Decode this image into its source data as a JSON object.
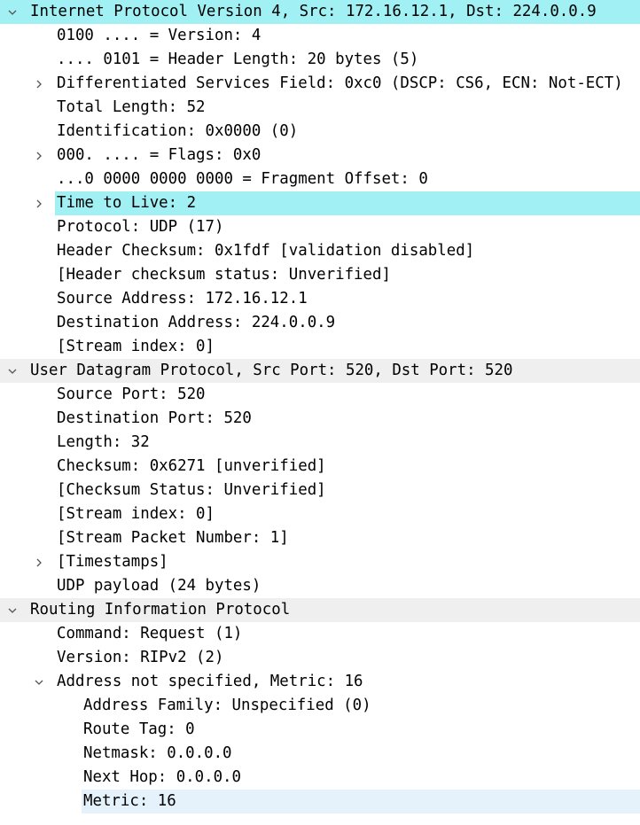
{
  "tree": {
    "rows": [
      {
        "text": "Internet Protocol Version 4, Src: 172.16.12.1, Dst: 224.0.0.9",
        "level": 0,
        "toggle": "expanded",
        "highlight": "cyan",
        "name": "ipv4-header-row"
      },
      {
        "text": "0100 .... = Version: 4",
        "level": 1,
        "toggle": "none",
        "highlight": "none",
        "name": "ipv4-version-row"
      },
      {
        "text": ".... 0101 = Header Length: 20 bytes (5)",
        "level": 1,
        "toggle": "none",
        "highlight": "none",
        "name": "ipv4-header-length-row"
      },
      {
        "text": "Differentiated Services Field: 0xc0 (DSCP: CS6, ECN: Not-ECT)",
        "level": 1,
        "toggle": "collapsed",
        "highlight": "none",
        "name": "ipv4-dsfield-row"
      },
      {
        "text": "Total Length: 52",
        "level": 1,
        "toggle": "none",
        "highlight": "none",
        "name": "ipv4-total-length-row"
      },
      {
        "text": "Identification: 0x0000 (0)",
        "level": 1,
        "toggle": "none",
        "highlight": "none",
        "name": "ipv4-identification-row"
      },
      {
        "text": "000. .... = Flags: 0x0",
        "level": 1,
        "toggle": "collapsed",
        "highlight": "none",
        "name": "ipv4-flags-row"
      },
      {
        "text": "...0 0000 0000 0000 = Fragment Offset: 0",
        "level": 1,
        "toggle": "none",
        "highlight": "none",
        "name": "ipv4-fragment-offset-row"
      },
      {
        "text": "Time to Live: 2",
        "level": 1,
        "toggle": "collapsed",
        "highlight": "cyan",
        "name": "ipv4-ttl-row"
      },
      {
        "text": "Protocol: UDP (17)",
        "level": 1,
        "toggle": "none",
        "highlight": "none",
        "name": "ipv4-protocol-row"
      },
      {
        "text": "Header Checksum: 0x1fdf [validation disabled]",
        "level": 1,
        "toggle": "none",
        "highlight": "none",
        "name": "ipv4-checksum-row"
      },
      {
        "text": "[Header checksum status: Unverified]",
        "level": 1,
        "toggle": "none",
        "highlight": "none",
        "name": "ipv4-checksum-status-row"
      },
      {
        "text": "Source Address: 172.16.12.1",
        "level": 1,
        "toggle": "none",
        "highlight": "none",
        "name": "ipv4-source-address-row"
      },
      {
        "text": "Destination Address: 224.0.0.9",
        "level": 1,
        "toggle": "none",
        "highlight": "none",
        "name": "ipv4-destination-address-row"
      },
      {
        "text": "[Stream index: 0]",
        "level": 1,
        "toggle": "none",
        "highlight": "none",
        "name": "ipv4-stream-index-row"
      },
      {
        "text": "User Datagram Protocol, Src Port: 520, Dst Port: 520",
        "level": 0,
        "toggle": "expanded",
        "highlight": "grey",
        "name": "udp-header-row"
      },
      {
        "text": "Source Port: 520",
        "level": 1,
        "toggle": "none",
        "highlight": "none",
        "name": "udp-source-port-row"
      },
      {
        "text": "Destination Port: 520",
        "level": 1,
        "toggle": "none",
        "highlight": "none",
        "name": "udp-destination-port-row"
      },
      {
        "text": "Length: 32",
        "level": 1,
        "toggle": "none",
        "highlight": "none",
        "name": "udp-length-row"
      },
      {
        "text": "Checksum: 0x6271 [unverified]",
        "level": 1,
        "toggle": "none",
        "highlight": "none",
        "name": "udp-checksum-row"
      },
      {
        "text": "[Checksum Status: Unverified]",
        "level": 1,
        "toggle": "none",
        "highlight": "none",
        "name": "udp-checksum-status-row"
      },
      {
        "text": "[Stream index: 0]",
        "level": 1,
        "toggle": "none",
        "highlight": "none",
        "name": "udp-stream-index-row"
      },
      {
        "text": "[Stream Packet Number: 1]",
        "level": 1,
        "toggle": "none",
        "highlight": "none",
        "name": "udp-stream-packet-number-row"
      },
      {
        "text": "[Timestamps]",
        "level": 1,
        "toggle": "collapsed",
        "highlight": "none",
        "name": "udp-timestamps-row"
      },
      {
        "text": "UDP payload (24 bytes)",
        "level": 1,
        "toggle": "none",
        "highlight": "none",
        "name": "udp-payload-row"
      },
      {
        "text": "Routing Information Protocol",
        "level": 0,
        "toggle": "expanded",
        "highlight": "grey",
        "name": "rip-header-row"
      },
      {
        "text": "Command: Request (1)",
        "level": 1,
        "toggle": "none",
        "highlight": "none",
        "name": "rip-command-row"
      },
      {
        "text": "Version: RIPv2 (2)",
        "level": 1,
        "toggle": "none",
        "highlight": "none",
        "name": "rip-version-row"
      },
      {
        "text": "Address not specified, Metric: 16",
        "level": 1,
        "toggle": "expanded",
        "highlight": "none",
        "name": "rip-entry-row"
      },
      {
        "text": "Address Family: Unspecified (0)",
        "level": 2,
        "toggle": "none",
        "highlight": "none",
        "name": "rip-address-family-row"
      },
      {
        "text": "Route Tag: 0",
        "level": 2,
        "toggle": "none",
        "highlight": "none",
        "name": "rip-route-tag-row"
      },
      {
        "text": "Netmask: 0.0.0.0",
        "level": 2,
        "toggle": "none",
        "highlight": "none",
        "name": "rip-netmask-row"
      },
      {
        "text": "Next Hop: 0.0.0.0",
        "level": 2,
        "toggle": "none",
        "highlight": "none",
        "name": "rip-next-hop-row"
      },
      {
        "text": "Metric: 16",
        "level": 2,
        "toggle": "none",
        "highlight": "pale",
        "name": "rip-metric-row"
      }
    ]
  },
  "colors": {
    "cyan_highlight": "#a0f0f4",
    "section_grey": "#efefef",
    "selected_pale": "#e5f2fb"
  }
}
